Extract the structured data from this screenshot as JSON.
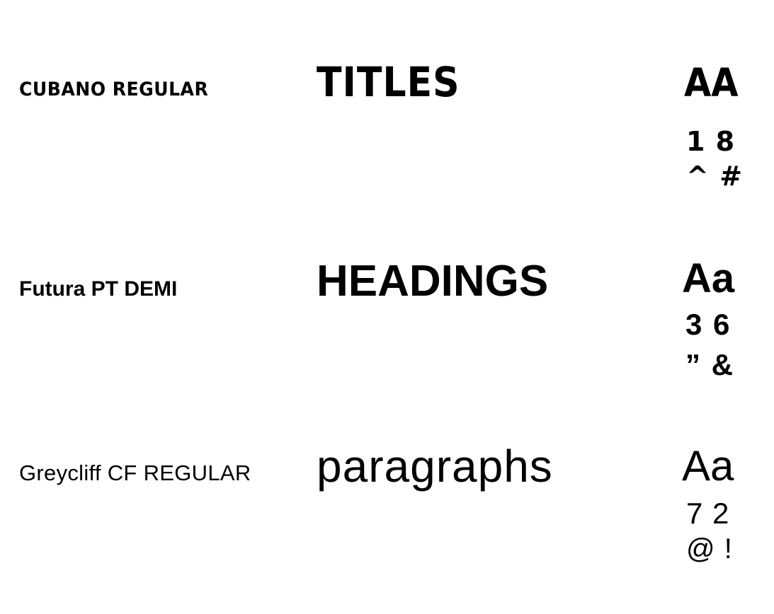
{
  "rows": [
    {
      "font_name": "CUBANO REGULAR",
      "usage": "TITLES",
      "sample_case": "AA",
      "sample_numbers": "1 8",
      "sample_symbols": "^ #"
    },
    {
      "font_name": "Futura PT DEMI",
      "usage": "HEADINGS",
      "sample_case": "Aa",
      "sample_numbers": "3 6",
      "sample_symbols": "” &"
    },
    {
      "font_name": "Greycliff CF REGULAR",
      "usage": "paragraphs",
      "sample_case": "Aa",
      "sample_numbers": "7 2",
      "sample_symbols": "@ !"
    }
  ],
  "colors": {
    "background": "#ffffff",
    "text": "#000000"
  }
}
